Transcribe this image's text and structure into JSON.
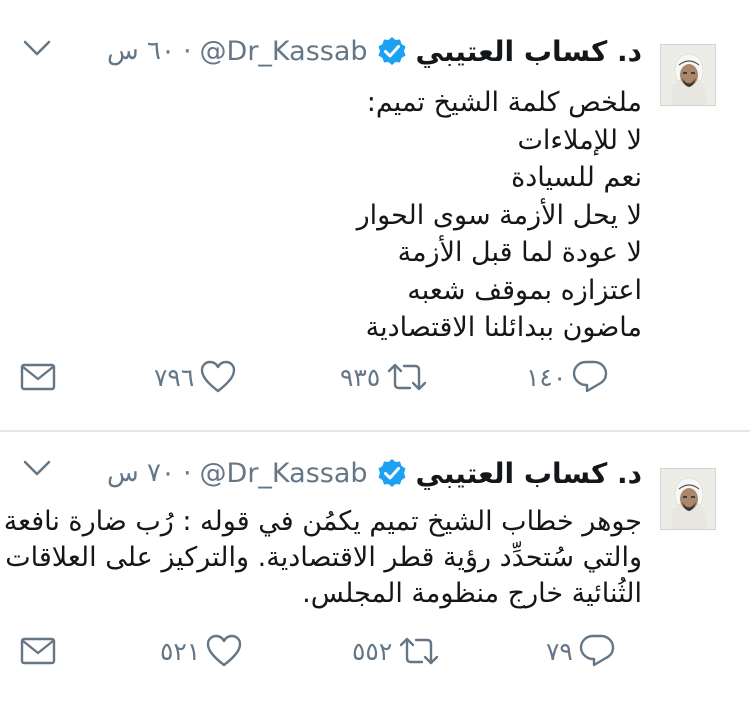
{
  "tweets": [
    {
      "author_name": "د. كساب العتيبي",
      "handle": "@Dr_Kassab",
      "separator": "·",
      "time": "٦٠ س",
      "lines": [
        "ملخص كلمة الشيخ تميم:",
        "لا للإملاءات",
        "نعم للسيادة",
        "لا يحل الأزمة سوى الحوار",
        "لا عودة لما قبل الأزمة",
        "اعتزازه بموقف شعبه",
        "ماضون ببدائلنا الاقتصادية"
      ],
      "reply_count": "١٤٠",
      "retweet_count": "٩٣٥",
      "like_count": "٧٩٦"
    },
    {
      "author_name": "د. كساب العتيبي",
      "handle": "@Dr_Kassab",
      "separator": "·",
      "time": "٧٠ س",
      "lines": [
        "جوهر خطاب الشيخ تميم يكمُن في قوله : رُب ضارة نافعة",
        "والتي سُتحدِّد رؤية قطر الاقتصادية. والتركيز على العلاقات",
        "الثُنائية خارج منظومة المجلس."
      ],
      "reply_count": "٧٩",
      "retweet_count": "٥٥٢",
      "like_count": "٥٢١"
    }
  ],
  "icons": {
    "verified": "verified-badge-icon",
    "chevron": "chevron-down-icon",
    "reply": "reply-icon",
    "retweet": "retweet-icon",
    "like": "heart-icon",
    "dm": "envelope-icon"
  },
  "colors": {
    "verified_blue": "#1da1f2",
    "text": "#14171a",
    "meta": "#657786",
    "divider": "#e1e8ed"
  }
}
